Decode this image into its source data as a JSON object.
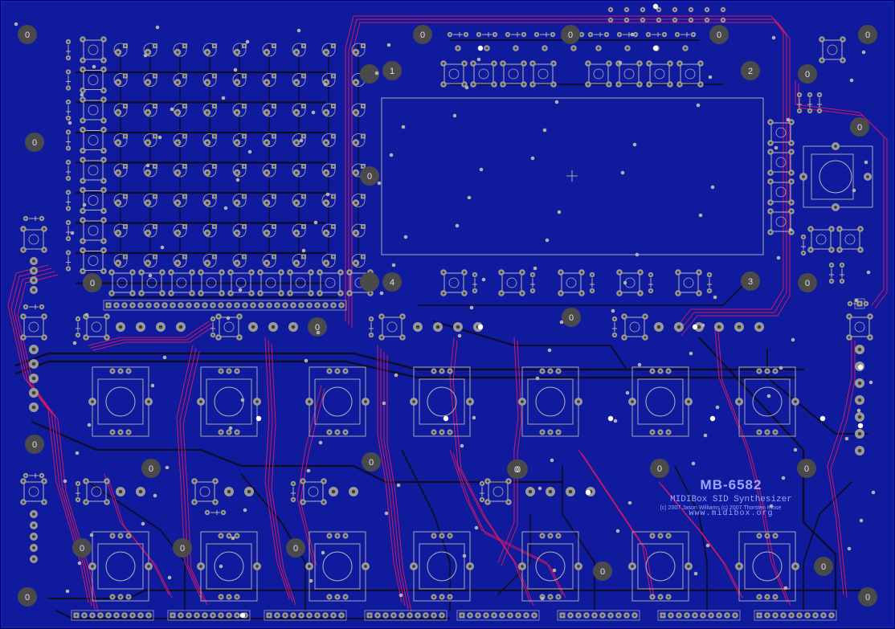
{
  "board": {
    "title": "MB-6582",
    "subtitle": "MIDIBox SID Synthesizer",
    "copyright": "(c) 2007 Jason Williams  (c) 2007 Thorsten Klose",
    "url": "www.midibox.org"
  },
  "colors": {
    "background": "#00006b",
    "board_fill": "#101a9c",
    "top_copper": "#cc1a66",
    "bottom_copper": "#0d0d28",
    "pad": "#9a9a9a",
    "hole": "#3c3c3c",
    "silk": "#b4b4b4",
    "title_text": "#9aa6ff"
  },
  "markers": {
    "mounting": "0",
    "zones": [
      "1",
      "2",
      "3",
      "4"
    ]
  }
}
